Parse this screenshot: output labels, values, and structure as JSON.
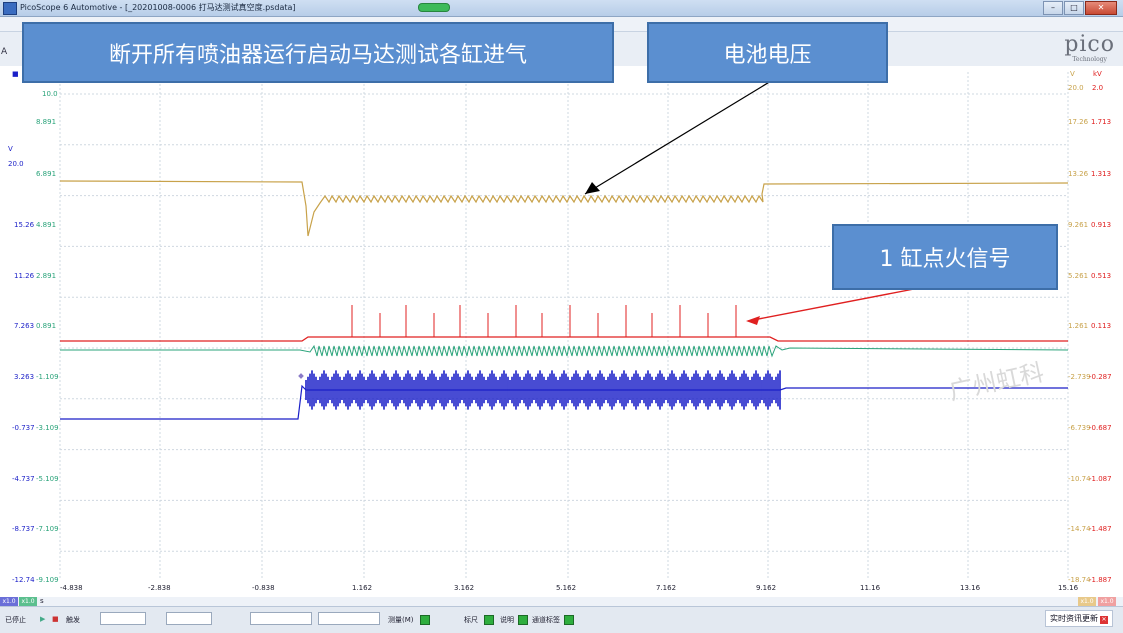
{
  "window": {
    "title": "PicoScope 6 Automotive - [_20201008-0006 打马达测试真空度.psdata]",
    "minimize_icon": "minimize-icon",
    "maximize_icon": "maximize-icon",
    "close_icon": "close-icon"
  },
  "toolbar": {
    "left_marker": "A"
  },
  "logo": {
    "mark": "pico",
    "sub": "Technology"
  },
  "annotations": {
    "callout_1": "断开所有喷油器运行启动马达测试各缸进气",
    "callout_2": "电池电压",
    "callout_3": "1 缸点火信号",
    "watermark": "广州虹科"
  },
  "colors": {
    "battery_voltage": "#c8a24a",
    "ignition": "#e02020",
    "green_trace": "#2aa37a",
    "blue_trace": "#1a1fc8",
    "callout_bg": "#5b8fd0"
  },
  "axes": {
    "left_outer_unit": "V",
    "left_outer": [
      "20.0",
      "15.26",
      "11.26",
      "7.263",
      "3.263",
      "-0.737",
      "-4.737",
      "-8.737",
      "-12.74"
    ],
    "left_inner": [
      "10.0",
      "8.891",
      "6.891",
      "4.891",
      "2.891",
      "0.891",
      "-1.109",
      "-3.109",
      "-5.109",
      "-7.109",
      "-9.109"
    ],
    "right_v_unit": "V",
    "right_v": [
      "20.0",
      "17.26",
      "13.26",
      "9.261",
      "5.261",
      "1.261",
      "-2.739",
      "-6.739",
      "-10.74",
      "-14.74",
      "-18.74"
    ],
    "right_kv_unit": "kV",
    "right_kv": [
      "2.0",
      "1.713",
      "1.313",
      "0.913",
      "0.513",
      "0.113",
      "-0.287",
      "-0.687",
      "-1.087",
      "-1.487",
      "-1.887"
    ],
    "x_ticks": [
      "-4.838",
      "-2.838",
      "-0.838",
      "1.162",
      "3.162",
      "5.162",
      "7.162",
      "9.162",
      "11.16",
      "13.16",
      "15.16"
    ],
    "x_unit": "s"
  },
  "channel_tags": {
    "a": "x1.0",
    "b": "x1.0",
    "c": "x1.0",
    "d": "x1.0"
  },
  "status": {
    "stopped": "已停止",
    "trigger": "触发",
    "measurements": "测量(M)",
    "rulers": "标尺",
    "notes": "说明",
    "channel_labels": "通道标签",
    "news": "实时资讯更新"
  }
}
